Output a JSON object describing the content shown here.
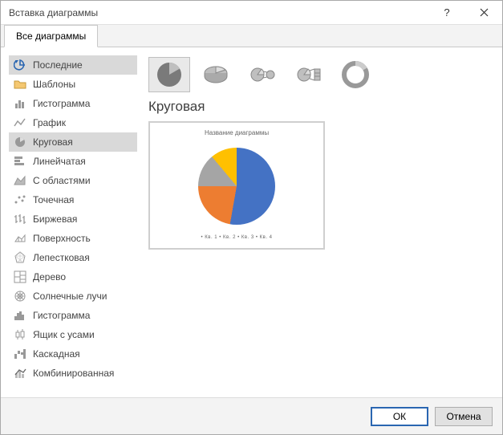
{
  "window": {
    "title": "Вставка диаграммы"
  },
  "tabs": [
    {
      "label": "Все диаграммы"
    }
  ],
  "sidebar": {
    "items": [
      {
        "label": "Последние"
      },
      {
        "label": "Шаблоны"
      },
      {
        "label": "Гистограмма"
      },
      {
        "label": "График"
      },
      {
        "label": "Круговая"
      },
      {
        "label": "Линейчатая"
      },
      {
        "label": "С областями"
      },
      {
        "label": "Точечная"
      },
      {
        "label": "Биржевая"
      },
      {
        "label": "Поверхность"
      },
      {
        "label": "Лепестковая"
      },
      {
        "label": "Дерево"
      },
      {
        "label": "Солнечные лучи"
      },
      {
        "label": "Гистограмма"
      },
      {
        "label": "Ящик с усами"
      },
      {
        "label": "Каскадная"
      },
      {
        "label": "Комбинированная"
      }
    ]
  },
  "content": {
    "selected_title": "Круговая",
    "preview_title": "Название диаграммы",
    "legend_text": "• Кв. 1    • Кв. 2    • Кв. 3    • Кв. 4"
  },
  "footer": {
    "ok": "ОК",
    "cancel": "Отмена"
  },
  "chart_data": {
    "type": "pie",
    "title": "Название диаграммы",
    "categories": [
      "Кв. 1",
      "Кв. 2",
      "Кв. 3",
      "Кв. 4"
    ],
    "values": [
      53,
      22,
      14,
      11
    ],
    "colors": [
      "#4472C4",
      "#ED7D31",
      "#A5A5A5",
      "#FFC000"
    ]
  }
}
